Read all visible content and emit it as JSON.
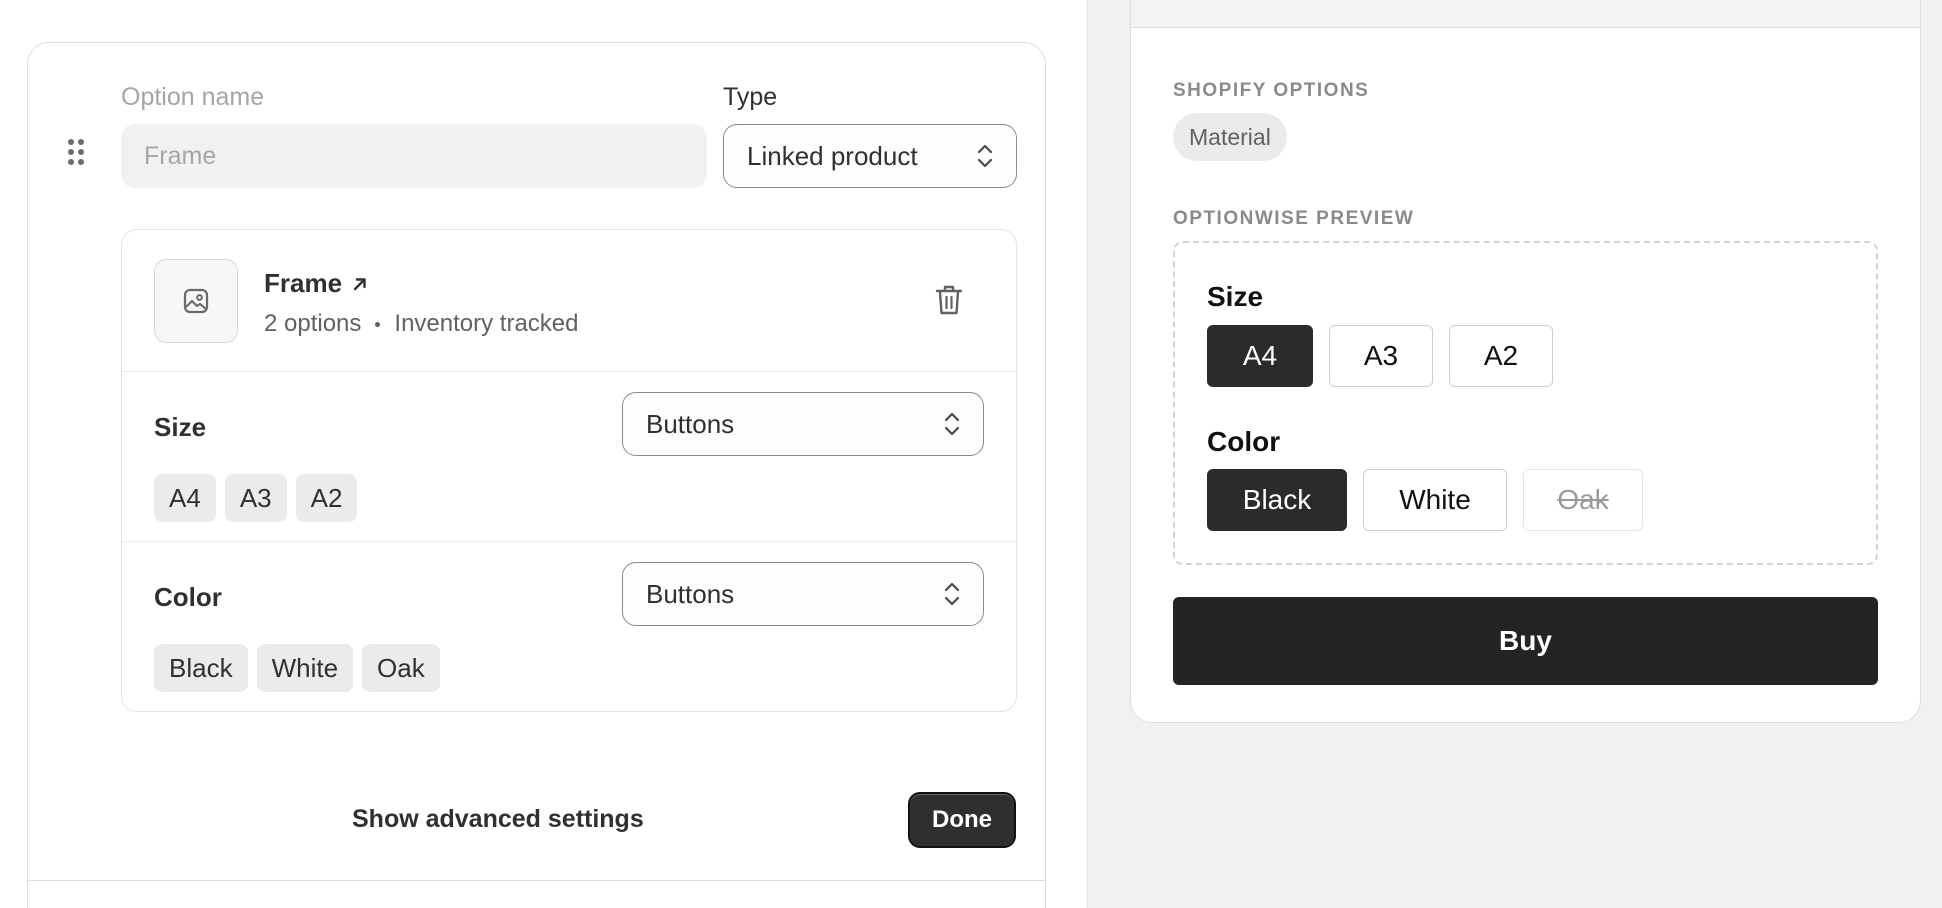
{
  "editor": {
    "option_name_label": "Option name",
    "option_name_placeholder": "Frame",
    "type_label": "Type",
    "type_value": "Linked product",
    "product": {
      "title": "Frame",
      "options_count": "2 options",
      "inventory": "Inventory tracked"
    },
    "size": {
      "label": "Size",
      "display": "Buttons",
      "values": [
        "A4",
        "A3",
        "A2"
      ]
    },
    "color": {
      "label": "Color",
      "display": "Buttons",
      "values": [
        "Black",
        "White",
        "Oak"
      ]
    },
    "advanced_label": "Show advanced settings",
    "done_label": "Done"
  },
  "preview": {
    "shopify_caption": "SHOPIFY OPTIONS",
    "material_pill": "Material",
    "preview_caption": "OPTIONWISE PREVIEW",
    "size_label": "Size",
    "size_values": [
      "A4",
      "A3",
      "A2"
    ],
    "color_label": "Color",
    "color_values": [
      "Black",
      "White",
      "Oak"
    ],
    "buy_label": "Buy"
  },
  "colors": {
    "selected": "#2b2b2b",
    "buy": "#232425",
    "chip_bg": "#ebebeb"
  }
}
